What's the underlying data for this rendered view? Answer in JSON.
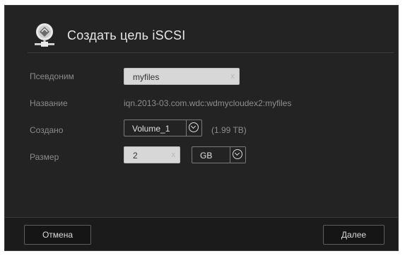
{
  "dialog": {
    "title": "Создать цель iSCSI",
    "icon": "cloud-network-icon"
  },
  "form": {
    "alias": {
      "label": "Псевдоним",
      "value": "myfiles",
      "clear_glyph": "x"
    },
    "name": {
      "label": "Название",
      "value": "iqn.2013-03.com.wdc:wdmycloudex2:myfiles"
    },
    "created_on": {
      "label": "Создано",
      "selected": "Volume_1",
      "capacity": "(1.99 TB)"
    },
    "size": {
      "label": "Размер",
      "value": "2",
      "clear_glyph": "x",
      "unit": "GB"
    }
  },
  "footer": {
    "cancel_label": "Отмена",
    "next_label": "Далее"
  },
  "colors": {
    "dialog_bg": "#232323",
    "footer_bg": "#1b1b1b",
    "label_text": "#8a8a8a",
    "input_bg": "#d7d7d7"
  }
}
